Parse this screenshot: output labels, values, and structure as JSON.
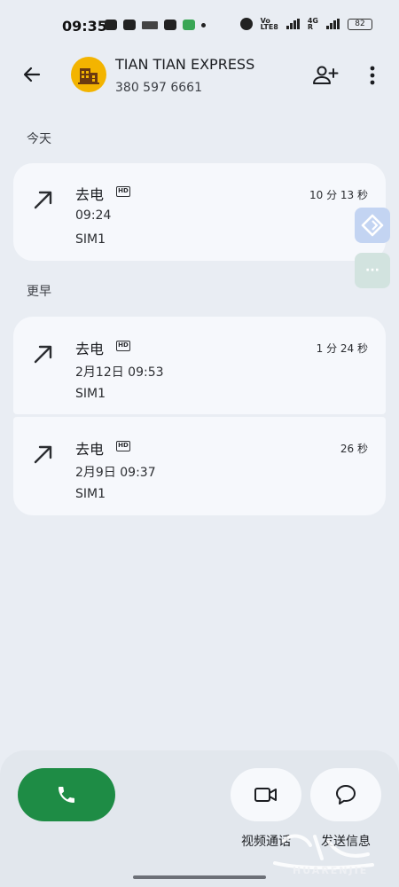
{
  "status_bar": {
    "time": "09:35",
    "network_top": "Vo",
    "network_bottom": "LTE8",
    "network_2_top": "4G",
    "network_2_bottom": "R",
    "battery": "82"
  },
  "header": {
    "contact_name": "TIAN TIAN EXPRESS",
    "phone_number": "380 597 6661"
  },
  "sections": {
    "today_label": "今天",
    "earlier_label": "更早"
  },
  "calls": [
    {
      "type": "去电",
      "hd": "HD",
      "time": "09:24",
      "sim": "SIM1",
      "duration": "10 分 13 秒"
    },
    {
      "type": "去电",
      "hd": "HD",
      "time": "2月12日 09:53",
      "sim": "SIM1",
      "duration": "1 分 24 秒"
    },
    {
      "type": "去电",
      "hd": "HD",
      "time": "2月9日 09:37",
      "sim": "SIM1",
      "duration": "26 秒"
    }
  ],
  "floating": {
    "more_dots": "···"
  },
  "actions": {
    "video_label": "视频通话",
    "message_label": "发送信息"
  },
  "watermark": {
    "text": "HUARENJIE"
  },
  "colors": {
    "background": "#e9edf3",
    "card": "#f6f8fc",
    "call_button": "#1e8c45",
    "avatar": "#f3b400"
  }
}
